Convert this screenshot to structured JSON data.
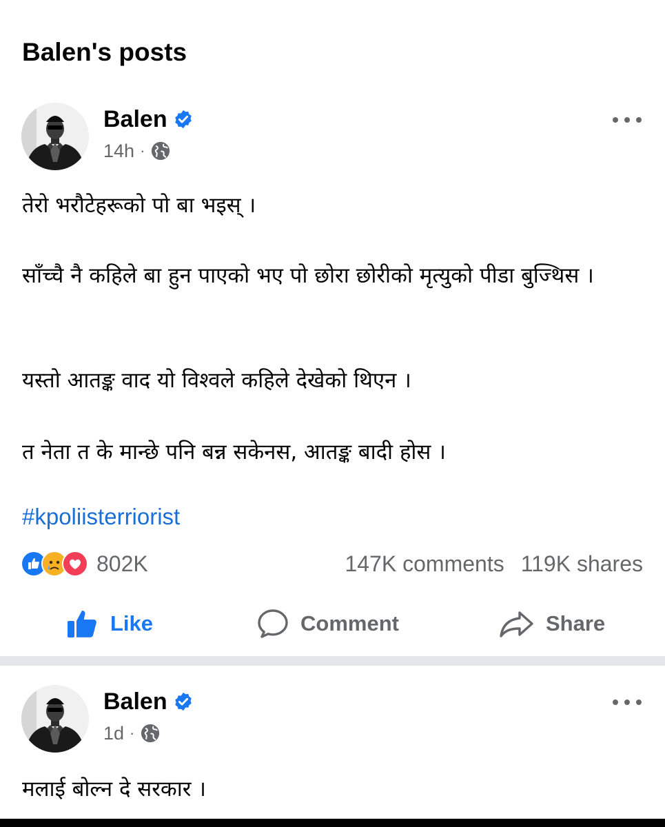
{
  "page": {
    "title": "Balen's posts"
  },
  "posts": [
    {
      "author": "Balen",
      "time": "14h",
      "separator": "·",
      "paragraphs": [
        "तेरो भरौटेहरूको पो बा भइस् ।",
        "साँच्चै नै कहिले बा हुन पाएको  भए पो छोरा छोरीको मृत्युको पीडा बुज्थिस ।",
        "यस्तो आतङ्क वाद यो विश्वले कहिले देखेको थिएन ।",
        "त नेता त के मान्छे पनि बन्न सकेनस, आतङ्क बादी होस ।"
      ],
      "hashtag": "#kpoliisterriorist",
      "reactions": {
        "count": "802K",
        "icons": [
          "like-reaction-icon",
          "sad-reaction-icon",
          "love-reaction-icon"
        ]
      },
      "comments": "147K comments",
      "shares": "119K shares",
      "actions": {
        "like": "Like",
        "comment": "Comment",
        "share": "Share"
      }
    },
    {
      "author": "Balen",
      "time": "1d",
      "separator": "·",
      "paragraphs": [
        "मलाई बोल्न दे सरकार ।"
      ]
    }
  ],
  "colors": {
    "accent": "#1877f2",
    "secondary_text": "#65676b",
    "hashtag": "#1a6ed8",
    "divider": "#e4e6eb"
  }
}
